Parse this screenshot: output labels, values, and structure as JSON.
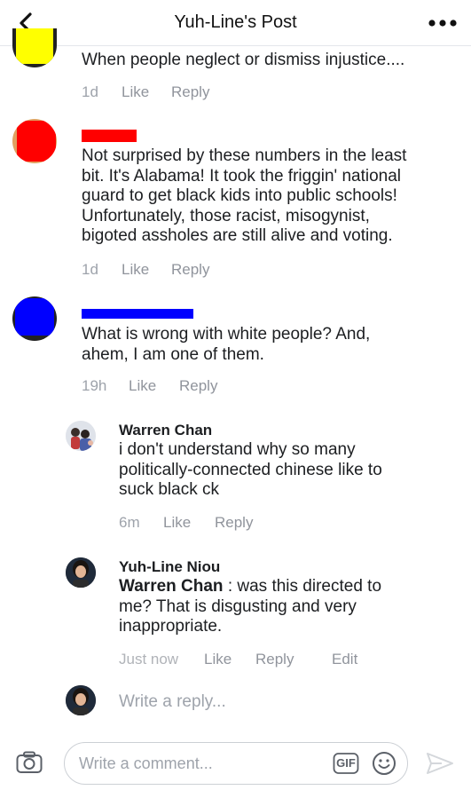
{
  "header": {
    "title": "Yuh-Line's Post",
    "back_icon": "chevron-left-icon",
    "more_icon": "ellipsis-icon"
  },
  "comments": [
    {
      "text": "When people neglect or dismiss injustice....",
      "time": "1d",
      "like": "Like",
      "reply": "Reply"
    },
    {
      "text_lines": [
        "Not surprised by these numbers in the least",
        "bit. It's Alabama! It took the friggin' national",
        "guard to get black kids into public schools!",
        "Unfortunately, those racist, misogynist,",
        "bigoted assholes are still alive and voting."
      ],
      "time": "1d",
      "like": "Like",
      "reply": "Reply"
    },
    {
      "text_lines": [
        "What is wrong with white people? And,",
        "ahem, I am one of them."
      ],
      "time": "19h",
      "like": "Like",
      "reply": "Reply"
    }
  ],
  "replies": [
    {
      "author": "Warren Chan",
      "text_lines": [
        "i don't understand why so many",
        "politically-connected chinese like to",
        "suck black ck"
      ],
      "time": "6m",
      "like": "Like",
      "reply": "Reply"
    },
    {
      "author": "Yuh-Line Niou",
      "mention": "Warren Chan",
      "text_lines": [
        " : was this directed to",
        "me? That is disgusting and very",
        "inappropriate."
      ],
      "time": "Just now",
      "like": "Like",
      "reply": "Reply",
      "edit": "Edit"
    }
  ],
  "reply_box": {
    "placeholder": "Write a reply..."
  },
  "composer": {
    "placeholder": "Write a comment...",
    "camera_icon": "camera-icon",
    "gif_label": "GIF",
    "emoji_icon": "smiley-icon",
    "send_icon": "send-icon"
  },
  "colors": {
    "redact_yellow": "#ffff00",
    "redact_red": "#ff0000",
    "redact_blue": "#0000ff",
    "meta_gray": "#90949c"
  }
}
